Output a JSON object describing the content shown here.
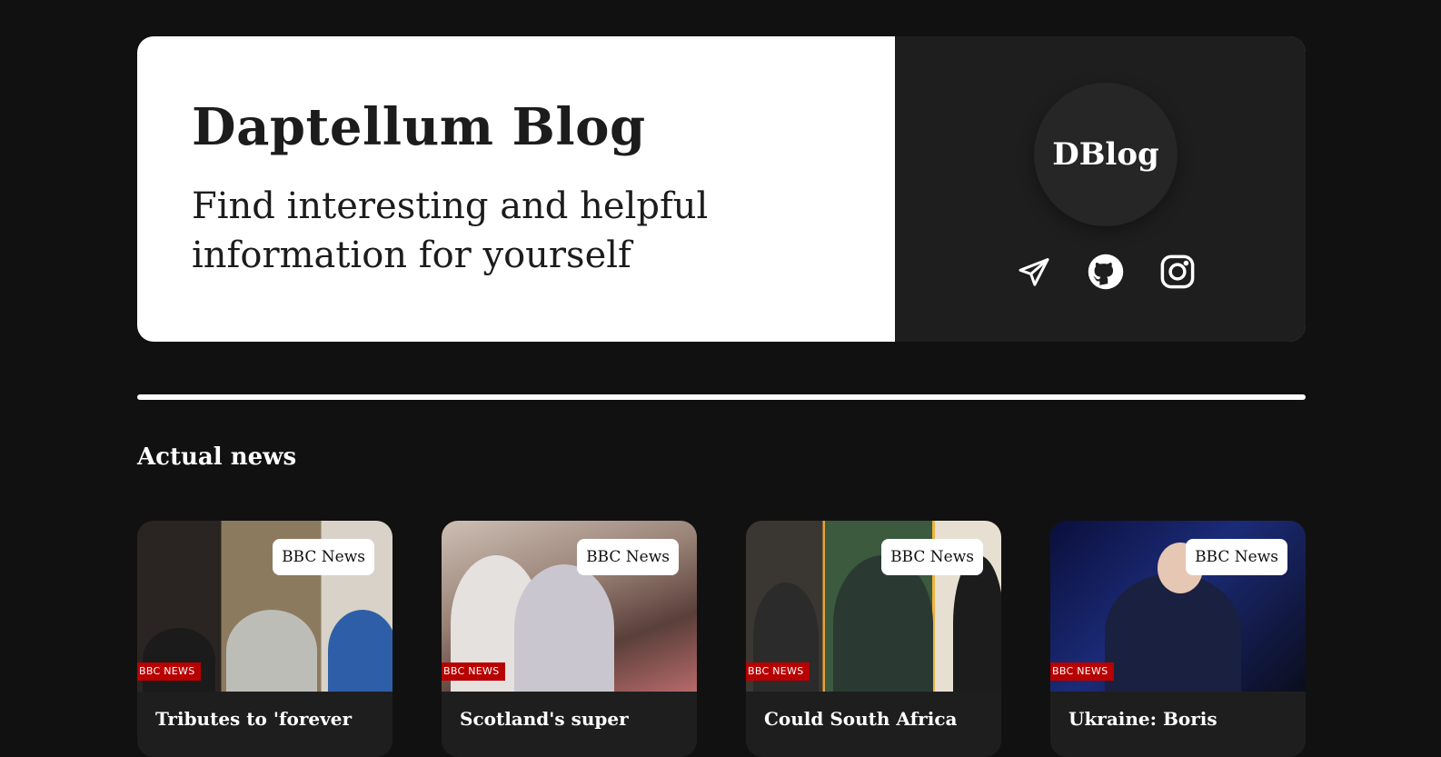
{
  "hero": {
    "title": "Daptellum Blog",
    "subtitle": "Find interesting and helpful information for yourself",
    "logo_text": "DBlog",
    "socials": [
      {
        "icon": "telegram-icon"
      },
      {
        "icon": "github-icon"
      },
      {
        "icon": "instagram-icon"
      }
    ]
  },
  "section": {
    "title": "Actual news"
  },
  "cards": [
    {
      "source": "BBC News",
      "logo": "BBC NEWS",
      "title": "Tributes to 'forever"
    },
    {
      "source": "BBC News",
      "logo": "BBC NEWS",
      "title": "Scotland's super"
    },
    {
      "source": "BBC News",
      "logo": "BBC NEWS",
      "title": "Could South Africa"
    },
    {
      "source": "BBC News",
      "logo": "BBC NEWS",
      "title": "Ukraine: Boris"
    }
  ],
  "colors": {
    "background": "#121112",
    "panel": "#1e1e1f",
    "hero": "#ffffff",
    "bbc_red": "#b80000"
  }
}
